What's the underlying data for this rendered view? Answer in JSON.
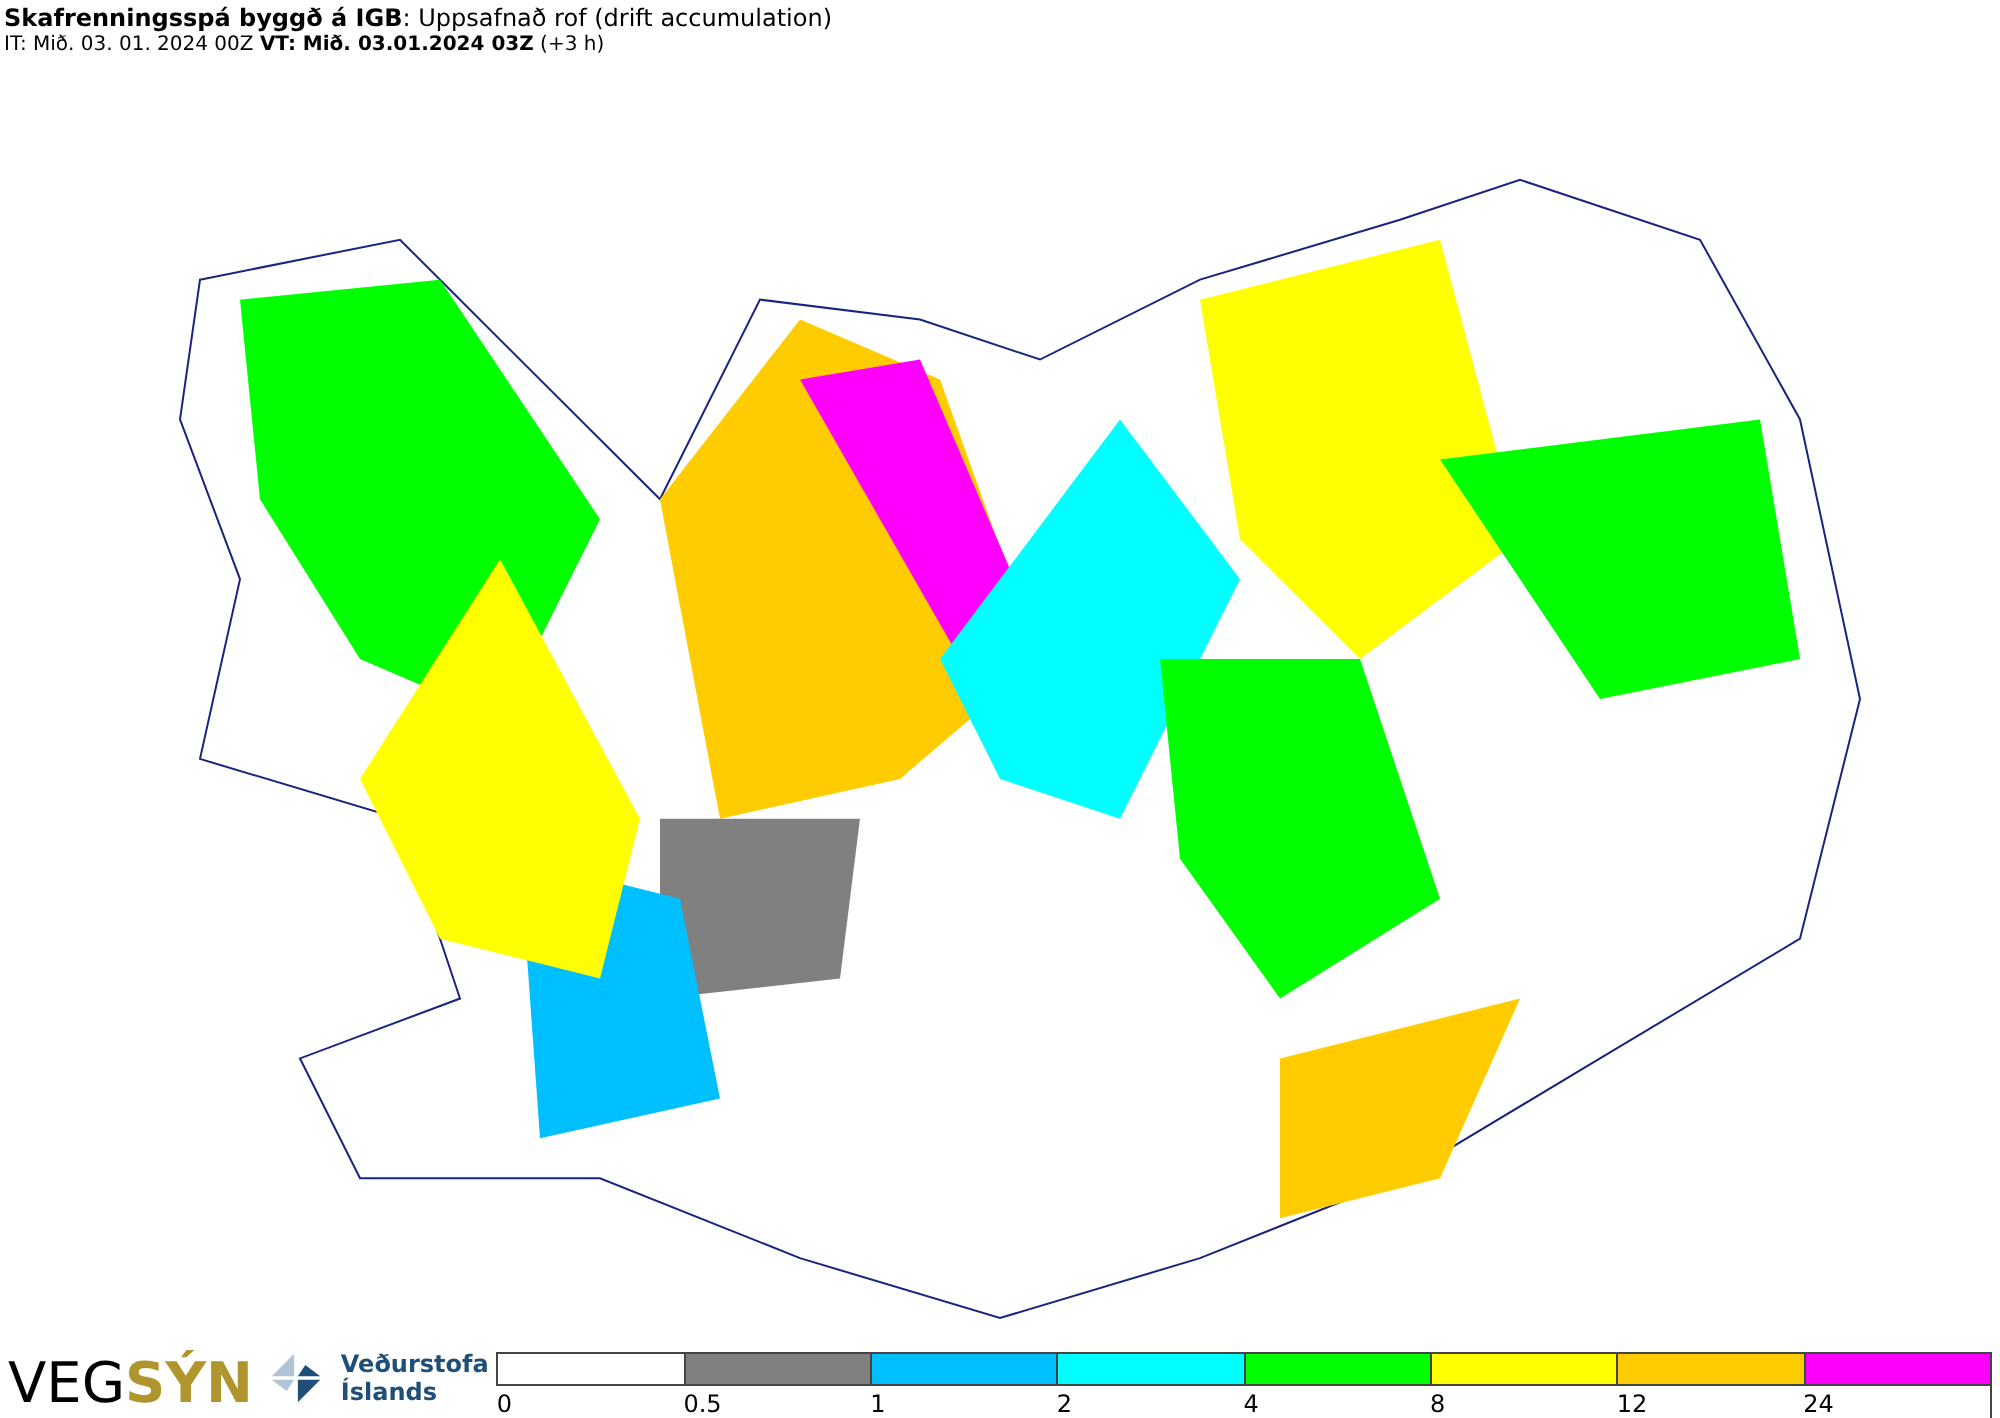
{
  "header": {
    "title": "**Skafrenningsspá byggð á IGB**: Uppsafnað rof (drift accumulation)",
    "subtitle": "IT: Mið. 03. 01. 2024 00Z **VT: Mið. 03.01.2024 03Z** (+3 h)"
  },
  "logos": {
    "vegsyn": [
      "VEG",
      "SÝN"
    ],
    "agency": "Veðurstofa Íslands"
  },
  "legend": [
    {
      "label": "0",
      "color": "#ffffff"
    },
    {
      "label": "0.5",
      "color": "#808080"
    },
    {
      "label": "1",
      "color": "#00bfff"
    },
    {
      "label": "2",
      "color": "#00ffff"
    },
    {
      "label": "4",
      "color": "#00ff00"
    },
    {
      "label": "8",
      "color": "#ffff00"
    },
    {
      "label": "12",
      "color": "#ffcc00"
    },
    {
      "label": "24",
      "color": "#ff00ff"
    }
  ]
}
